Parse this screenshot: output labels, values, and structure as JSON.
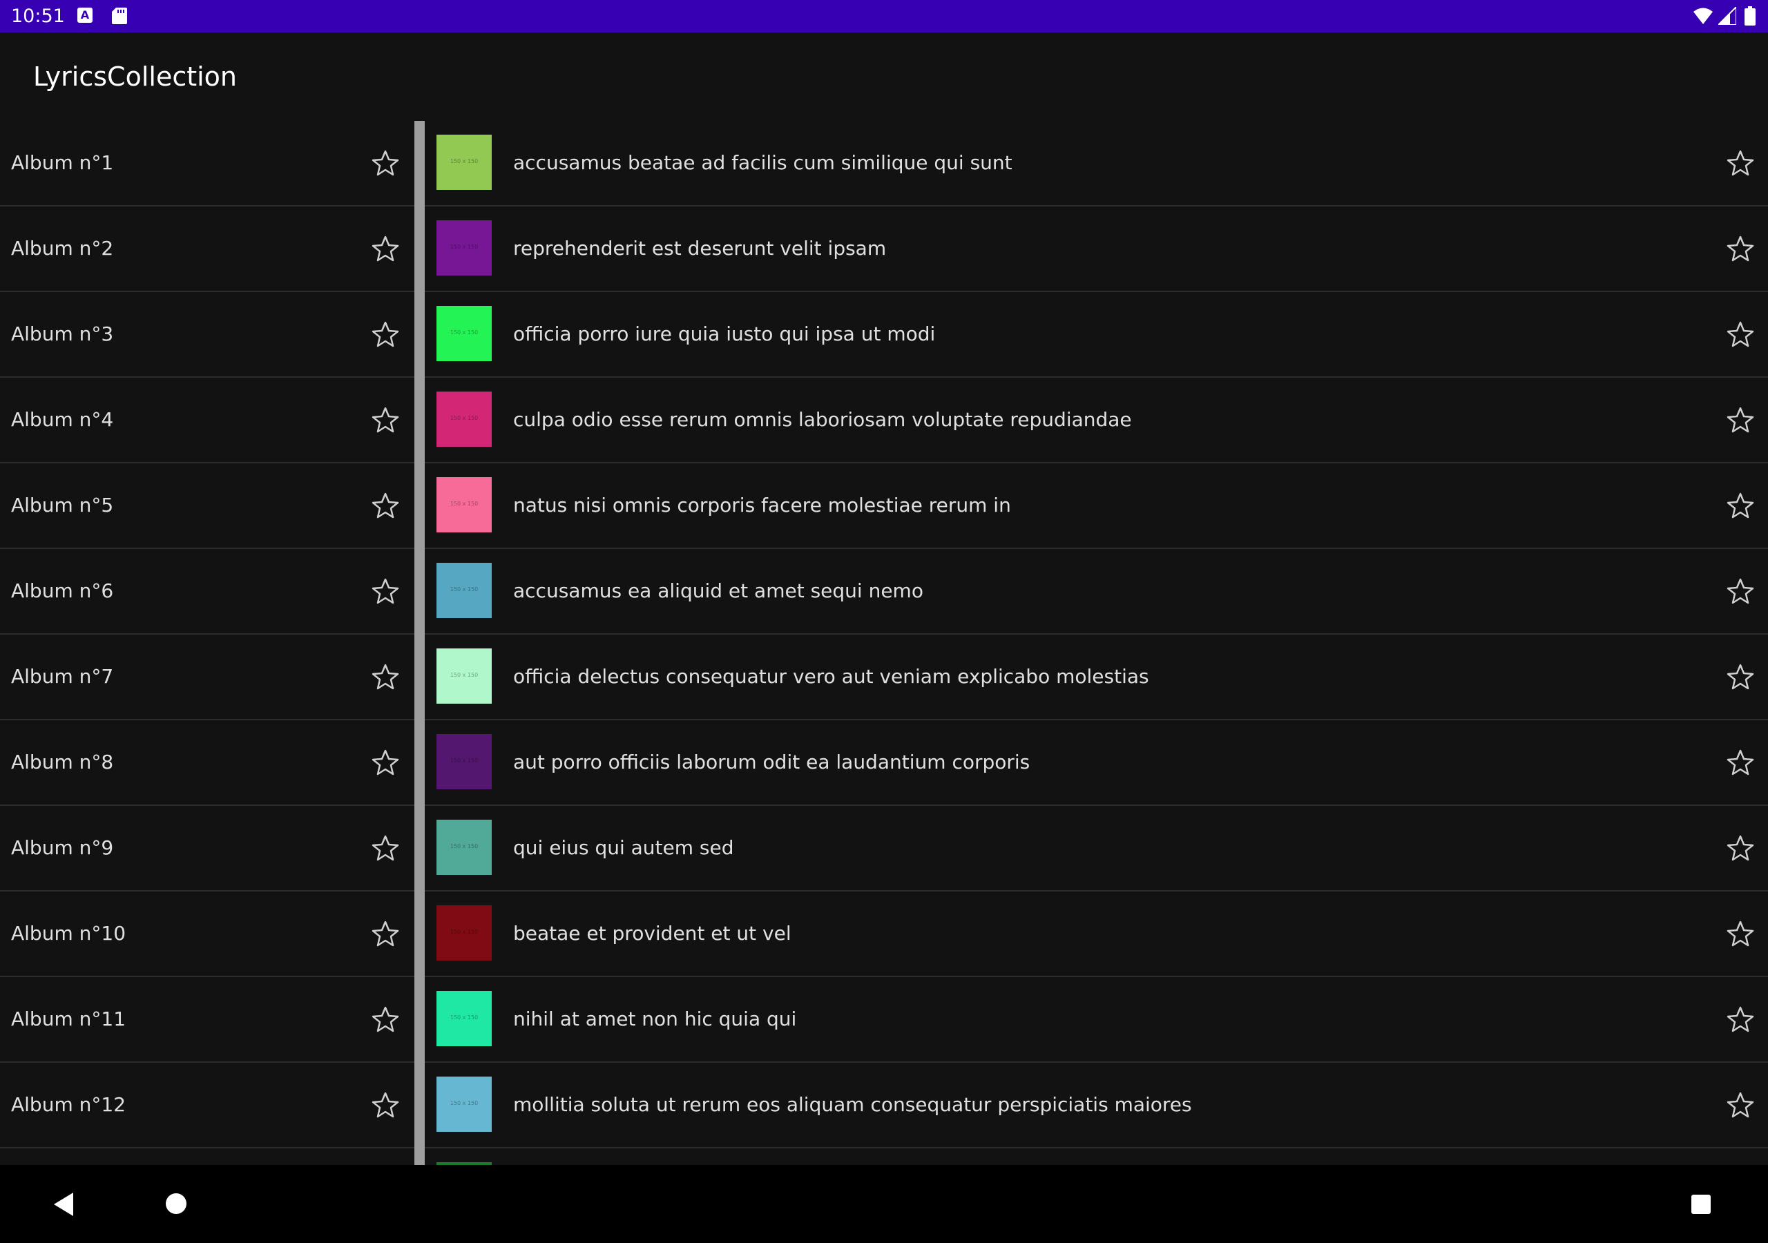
{
  "status_bar": {
    "time": "10:51",
    "icons": [
      "text-a-icon",
      "sd-card-icon",
      "wifi-icon",
      "signal-icon",
      "battery-icon"
    ],
    "background_color": "#3700b3"
  },
  "app_bar": {
    "title": "LyricsCollection"
  },
  "albums": [
    {
      "label": "Album n°1",
      "favorite": false
    },
    {
      "label": "Album n°2",
      "favorite": false
    },
    {
      "label": "Album n°3",
      "favorite": false
    },
    {
      "label": "Album n°4",
      "favorite": false
    },
    {
      "label": "Album n°5",
      "favorite": false
    },
    {
      "label": "Album n°6",
      "favorite": false
    },
    {
      "label": "Album n°7",
      "favorite": false
    },
    {
      "label": "Album n°8",
      "favorite": false
    },
    {
      "label": "Album n°9",
      "favorite": false
    },
    {
      "label": "Album n°10",
      "favorite": false
    },
    {
      "label": "Album n°11",
      "favorite": false
    },
    {
      "label": "Album n°12",
      "favorite": false
    },
    {
      "label": "",
      "favorite": false
    }
  ],
  "songs": [
    {
      "title": "accusamus beatae ad facilis cum similique qui sunt",
      "thumb_color": "#92c952",
      "thumb_text": "150 x 150"
    },
    {
      "title": "reprehenderit est deserunt velit ipsam",
      "thumb_color": "#771796",
      "thumb_text": "150 x 150"
    },
    {
      "title": "officia porro iure quia iusto qui ipsa ut modi",
      "thumb_color": "#24f355",
      "thumb_text": "150 x 150"
    },
    {
      "title": "culpa odio esse rerum omnis laboriosam voluptate repudiandae",
      "thumb_color": "#d32776",
      "thumb_text": "150 x 150"
    },
    {
      "title": "natus nisi omnis corporis facere molestiae rerum in",
      "thumb_color": "#f66b97",
      "thumb_text": "150 x 150"
    },
    {
      "title": "accusamus ea aliquid et amet sequi nemo",
      "thumb_color": "#56a8c2",
      "thumb_text": "150 x 150"
    },
    {
      "title": "officia delectus consequatur vero aut veniam explicabo molestias",
      "thumb_color": "#b0f7cc",
      "thumb_text": "150 x 150"
    },
    {
      "title": "aut porro officiis laborum odit ea laudantium corporis",
      "thumb_color": "#54176f",
      "thumb_text": "150 x 150"
    },
    {
      "title": "qui eius qui autem sed",
      "thumb_color": "#51aa97",
      "thumb_text": "150 x 150"
    },
    {
      "title": "beatae et provident et ut vel",
      "thumb_color": "#810b14",
      "thumb_text": "150 x 150"
    },
    {
      "title": "nihil at amet non hic quia qui",
      "thumb_color": "#1ee8a4",
      "thumb_text": "150 x 150"
    },
    {
      "title": "mollitia soluta ut rerum eos aliquam consequatur perspiciatis maiores",
      "thumb_color": "#66b7d2",
      "thumb_text": "150 x 150"
    },
    {
      "title": "",
      "thumb_color": "#197d29",
      "thumb_text": ""
    }
  ],
  "nav_bar": {
    "icons": [
      "back-icon",
      "home-icon",
      "recents-icon"
    ]
  }
}
